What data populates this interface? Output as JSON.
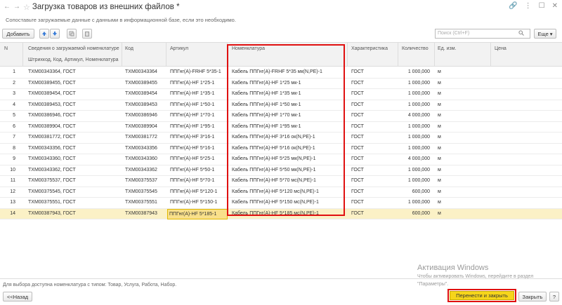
{
  "window": {
    "title": "Загрузка товаров из внешних файлов *",
    "hint": "Сопоставьте загружаемые данные с данными в информационной базе, если это необходимо."
  },
  "toolbar": {
    "add_label": "Добавить",
    "search_placeholder": "Поиск (Ctrl+F)",
    "more_label": "Еще"
  },
  "table": {
    "headers": {
      "n": "N",
      "info": "Сведения о загружаемой номенклатуре",
      "info_sub": "Штрихкод, Код, Артикул, Номенклатура",
      "code": "Код",
      "article": "Артикул",
      "nomenclature": "Номенклатура",
      "characteristic": "Характеристика",
      "quantity": "Количество",
      "unit": "Ед. изм.",
      "price": "Цена"
    },
    "rows": [
      {
        "n": "1",
        "info": "ТХМ00343364, ГОСТ",
        "code": "ТХМ00343364",
        "article": "ППГнг(А)-FRHF 5*35-1",
        "nom": "Кабель ППГнг(А)-FRHF 5*35 мк(N,PE)-1",
        "char": "ГОСТ",
        "qty": "1 000,000",
        "unit": "м"
      },
      {
        "n": "2",
        "info": "ТХМ00389455, ГОСТ",
        "code": "ТХМ00389455",
        "article": "ППГнг(А)-HF 1*25-1",
        "nom": "Кабель ППГнг(А)-HF 1*25 мк-1",
        "char": "ГОСТ",
        "qty": "1 000,000",
        "unit": "м"
      },
      {
        "n": "3",
        "info": "ТХМ00389454, ГОСТ",
        "code": "ТХМ00389454",
        "article": "ППГнг(А)-HF 1*35-1",
        "nom": "Кабель ППГнг(А)-HF 1*35 мк-1",
        "char": "ГОСТ",
        "qty": "1 000,000",
        "unit": "м"
      },
      {
        "n": "4",
        "info": "ТХМ00389453, ГОСТ",
        "code": "ТХМ00389453",
        "article": "ППГнг(А)-HF 1*50-1",
        "nom": "Кабель ППГнг(А)-HF 1*50 мк-1",
        "char": "ГОСТ",
        "qty": "1 000,000",
        "unit": "м"
      },
      {
        "n": "5",
        "info": "ТХМ00386946, ГОСТ",
        "code": "ТХМ00386946",
        "article": "ППГнг(А)-HF 1*70-1",
        "nom": "Кабель ППГнг(А)-HF 1*70 мк-1",
        "char": "ГОСТ",
        "qty": "4 000,000",
        "unit": "м"
      },
      {
        "n": "6",
        "info": "ТХМ00389904, ГОСТ",
        "code": "ТХМ00389904",
        "article": "ППГнг(А)-HF 1*95-1",
        "nom": "Кабель ППГнг(А)-HF 1*95 мк-1",
        "char": "ГОСТ",
        "qty": "1 000,000",
        "unit": "м"
      },
      {
        "n": "7",
        "info": "ТХМ00381772, ГОСТ",
        "code": "ТХМ00381772",
        "article": "ППГнг(А)-HF 3*16-1",
        "nom": "Кабель ППГнг(А)-HF 3*16 ок(N,PE)-1",
        "char": "ГОСТ",
        "qty": "1 000,000",
        "unit": "м"
      },
      {
        "n": "8",
        "info": "ТХМ00343356, ГОСТ",
        "code": "ТХМ00343356",
        "article": "ППГнг(А)-HF 5*16-1",
        "nom": "Кабель ППГнг(А)-HF 5*16 ок(N,PE)-1",
        "char": "ГОСТ",
        "qty": "1 000,000",
        "unit": "м"
      },
      {
        "n": "9",
        "info": "ТХМ00343360, ГОСТ",
        "code": "ТХМ00343360",
        "article": "ППГнг(А)-HF 5*25-1",
        "nom": "Кабель ППГнг(А)-HF 5*25 мк(N,PE)-1",
        "char": "ГОСТ",
        "qty": "4 000,000",
        "unit": "м"
      },
      {
        "n": "10",
        "info": "ТХМ00343362, ГОСТ",
        "code": "ТХМ00343362",
        "article": "ППГнг(А)-HF 5*50-1",
        "nom": "Кабель ППГнг(А)-HF 5*50 мк(N,PE)-1",
        "char": "ГОСТ",
        "qty": "1 000,000",
        "unit": "м"
      },
      {
        "n": "11",
        "info": "ТХМ00375537, ГОСТ",
        "code": "ТХМ00375537",
        "article": "ППГнг(А)-HF 5*70-1",
        "nom": "Кабель ППГнг(А)-HF 5*70 мс(N,PE)-1",
        "char": "ГОСТ",
        "qty": "1 000,000",
        "unit": "м"
      },
      {
        "n": "12",
        "info": "ТХМ00375545, ГОСТ",
        "code": "ТХМ00375545",
        "article": "ППГнг(А)-HF 5*120-1",
        "nom": "Кабель ППГнг(А)-HF 5*120 мс(N,PE)-1",
        "char": "ГОСТ",
        "qty": "600,000",
        "unit": "м"
      },
      {
        "n": "13",
        "info": "ТХМ00375551, ГОСТ",
        "code": "ТХМ00375551",
        "article": "ППГнг(А)-HF 5*150-1",
        "nom": "Кабель ППГнг(А)-HF 5*150 мс(N,PE)-1",
        "char": "ГОСТ",
        "qty": "1 000,000",
        "unit": "м"
      },
      {
        "n": "14",
        "info": "ТХМ00387943, ГОСТ",
        "code": "ТХМ00387943",
        "article": "ППГнг(А)-HF 5*185-1",
        "nom": "Кабель ППГнг(А)-HF 5*185 мс(N,PE)-1",
        "char": "ГОСТ",
        "qty": "600,000",
        "unit": "м"
      }
    ]
  },
  "footer": {
    "note": "Для выбора доступна номенклатура с типом: Товар, Услуга, Работа, Набор.",
    "back_label": "<<Назад",
    "transfer_label": "Перенести и закрыть",
    "close_label": "Закрыть",
    "help_label": "?"
  },
  "watermark": {
    "title": "Активация Windows",
    "line1": "Чтобы активировать Windows, перейдите в раздел",
    "line2": "\"Параметры\"."
  },
  "colors": {
    "primary_button": "#f6d51a",
    "highlight_box": "#e01010",
    "selected_row": "#fbf1c6"
  }
}
